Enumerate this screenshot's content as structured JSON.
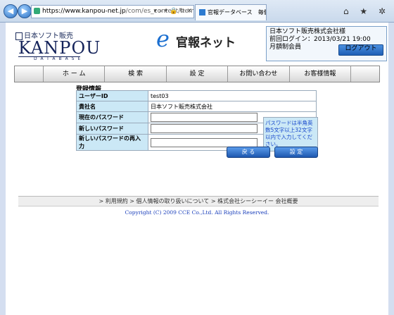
{
  "browser": {
    "url_host": "https://www.kanpou-net.jp",
    "url_rest": "/com/es_content/Itemid,1(",
    "url_tools": "▾ ⌕ ▾ 🔒 ↻ ✕",
    "tab_title": "官報データベース　毎個…",
    "tab_close": "✕",
    "window_icons": "⌂ ★ ✲"
  },
  "header": {
    "company_small": "日本ソフト販売",
    "logo": "KANPOU",
    "logo_sub": "DATABASE",
    "brand_e": "e",
    "brand_text": "官報ネット"
  },
  "user": {
    "company": "日本ソフト販売株式会社様",
    "last_login": "前回ログイン：2013/03/21 19:00",
    "plan": "月額制会員",
    "logout_label": "ログアウト"
  },
  "nav": {
    "items": [
      "ホ ー ム",
      "検 索",
      "設 定",
      "お問い合わせ",
      "お客様情報"
    ]
  },
  "form": {
    "section_title": "登録情報",
    "rows": [
      {
        "label": "ユーザーID",
        "value": "test03"
      },
      {
        "label": "貴社名",
        "value": "日本ソフト販売株式会社"
      }
    ],
    "password_labels": [
      "現在のパスワード",
      "新しいパスワード",
      "新しいパスワードの再入力"
    ],
    "note": "パスワードは半角英数5文字以上32文字以内で入力してください。",
    "back_label": "戻 る",
    "submit_label": "設 定"
  },
  "footer": {
    "links": [
      "利用規約",
      "個人情報の取り扱いについて",
      "株式会社シーシーイー 会社概要"
    ],
    "copyright": "Copyright (C) 2009 CCE Co.,Ltd. All Rights Reserved."
  }
}
